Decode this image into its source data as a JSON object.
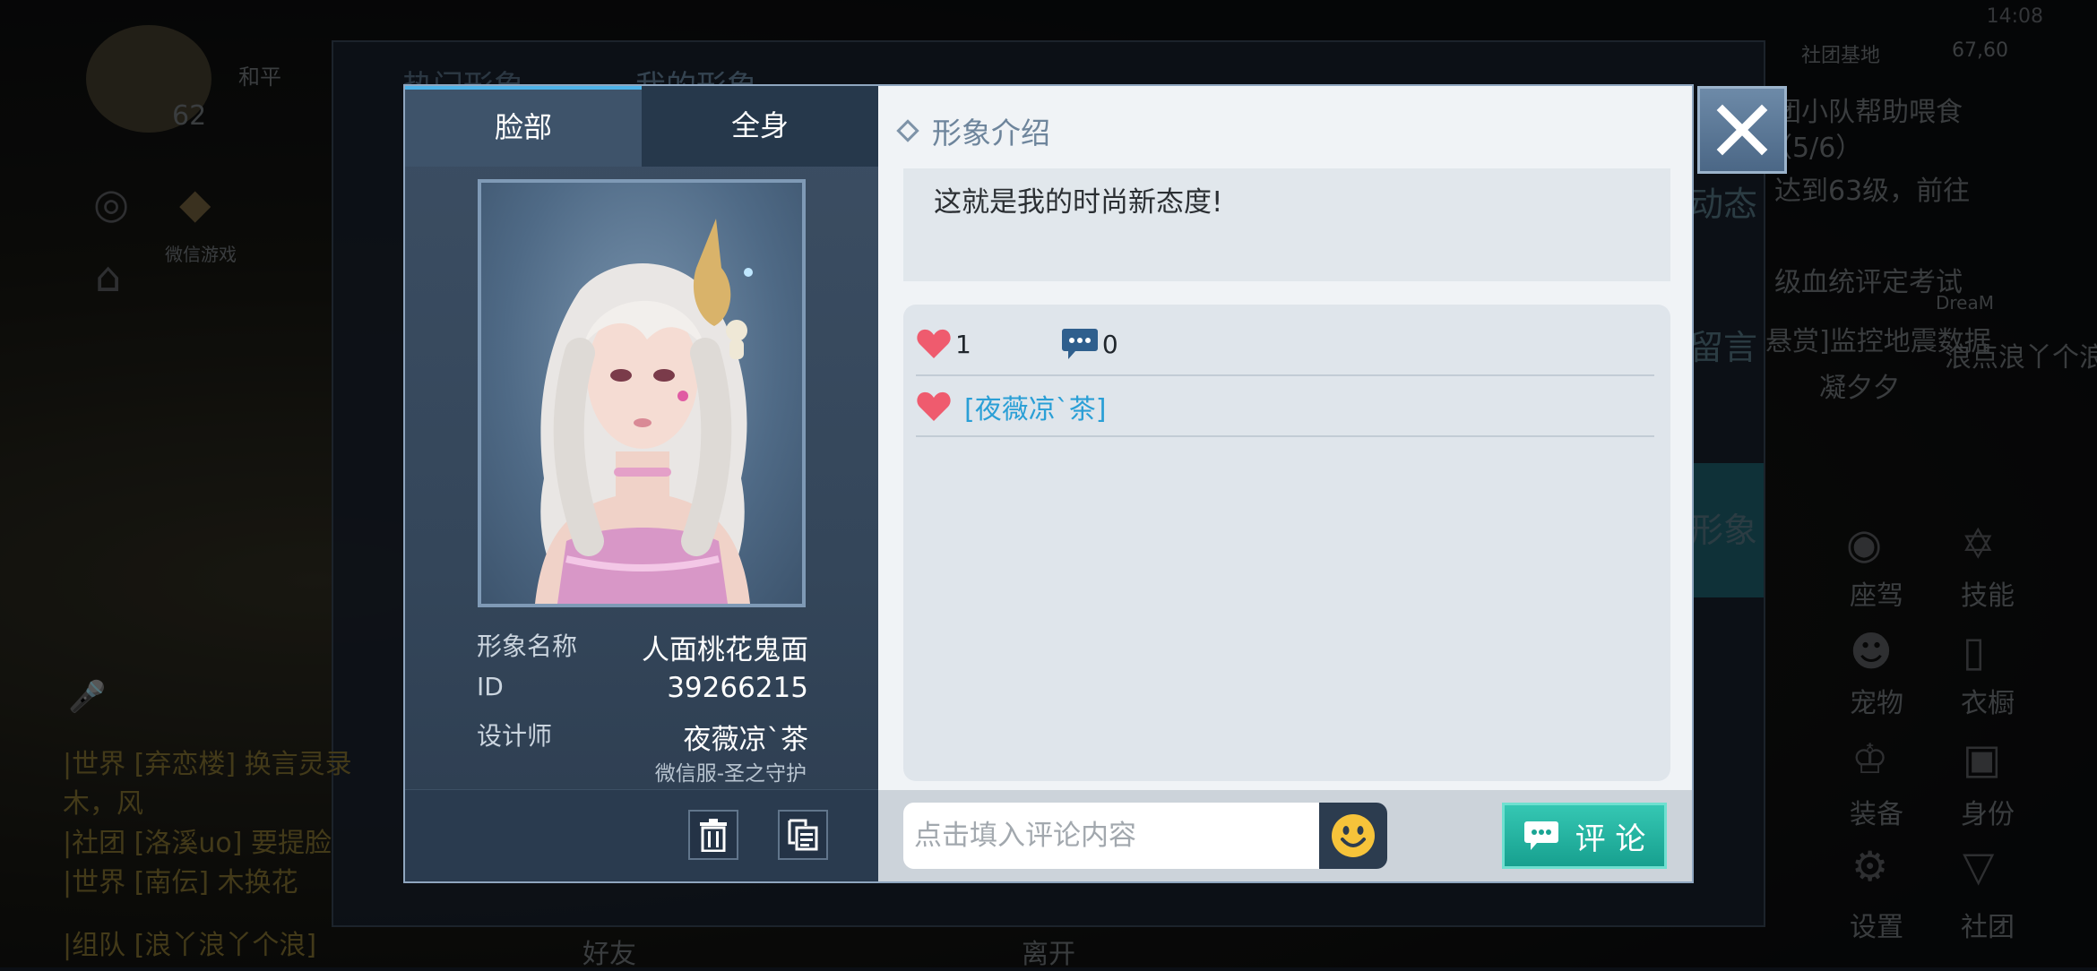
{
  "status_bar": {
    "time": "14:08"
  },
  "background": {
    "level": "62",
    "player_tag": "和平",
    "wechat_tile": "微信游戏",
    "back_tabs": [
      "热门形象",
      "我的形象"
    ],
    "side_tabs": [
      "动态",
      "留言",
      "形象"
    ],
    "right_list": [
      "社团基地",
      "67,60",
      "团小队帮助喂食",
      "（5/6）",
      "达到63级，前往",
      "级血统评定考试",
      "悬赏]监控地震数据",
      "DreaM",
      "凝夕夕",
      "浪点浪丫个浪"
    ],
    "chat_lines": [
      "|世界 [弃恋楼] 换言灵录",
      "木，风",
      "|社团 [洛溪uo] 要提脸",
      "|世界 [南伝] 木换花",
      "|组队 [浪丫浪丫个浪]"
    ],
    "bottom_bar": [
      "好友",
      "离开"
    ],
    "menu": [
      "座驾",
      "技能",
      "宠物",
      "衣橱",
      "装备",
      "身份",
      "设置",
      "社团"
    ]
  },
  "dialog": {
    "tabs": {
      "face": "脸部",
      "full_body": "全身"
    },
    "info": {
      "name_label": "形象名称",
      "name_value": "人面桃花鬼面",
      "id_label": "ID",
      "id_value": "39266215",
      "designer_label": "设计师",
      "designer_value": "夜薇凉`茶",
      "server": "微信服-圣之守护"
    },
    "intro": {
      "title": "形象介绍",
      "text": "这就是我的时尚新态度!"
    },
    "stats": {
      "likes": "1",
      "comments": "0"
    },
    "likers": [
      "[夜薇凉`茶]"
    ],
    "comment": {
      "placeholder": "点击填入评论内容",
      "value": "",
      "submit_label": "评 论"
    },
    "colors": {
      "accent_teal": "#1fb3a0",
      "like_red": "#ef5b6e",
      "link_blue": "#2a9fd6"
    }
  }
}
